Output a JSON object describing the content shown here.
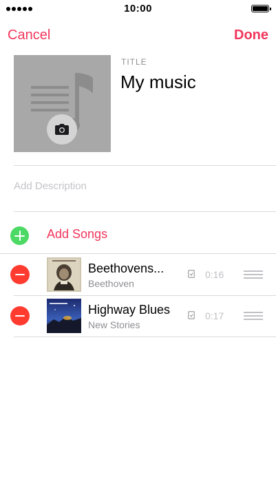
{
  "status_bar": {
    "time": "10:00",
    "signal_bars": 5,
    "battery_level": 1.0
  },
  "nav": {
    "cancel_label": "Cancel",
    "done_label": "Done",
    "accent_color": "#f2355b"
  },
  "artwork": {
    "placeholder_icon": "music-note-list-icon",
    "camera_icon": "camera-icon"
  },
  "title_field": {
    "label": "TITLE",
    "value": "My music"
  },
  "description_field": {
    "placeholder": "Add Description"
  },
  "add_songs": {
    "label": "Add Songs",
    "icon": "add-circle-icon",
    "color": "#4cd964"
  },
  "songs": [
    {
      "title": "Beethovens...",
      "artist": "Beethoven",
      "duration": "0:16",
      "art": "beethoven-portrait-cover"
    },
    {
      "title": "Highway Blues",
      "artist": "New Stories",
      "duration": "0:17",
      "art": "night-sky-cover"
    }
  ],
  "colors": {
    "remove": "#ff3b30",
    "secondary_text": "#8e8e93",
    "artwork_bg": "#a8a8a8"
  }
}
